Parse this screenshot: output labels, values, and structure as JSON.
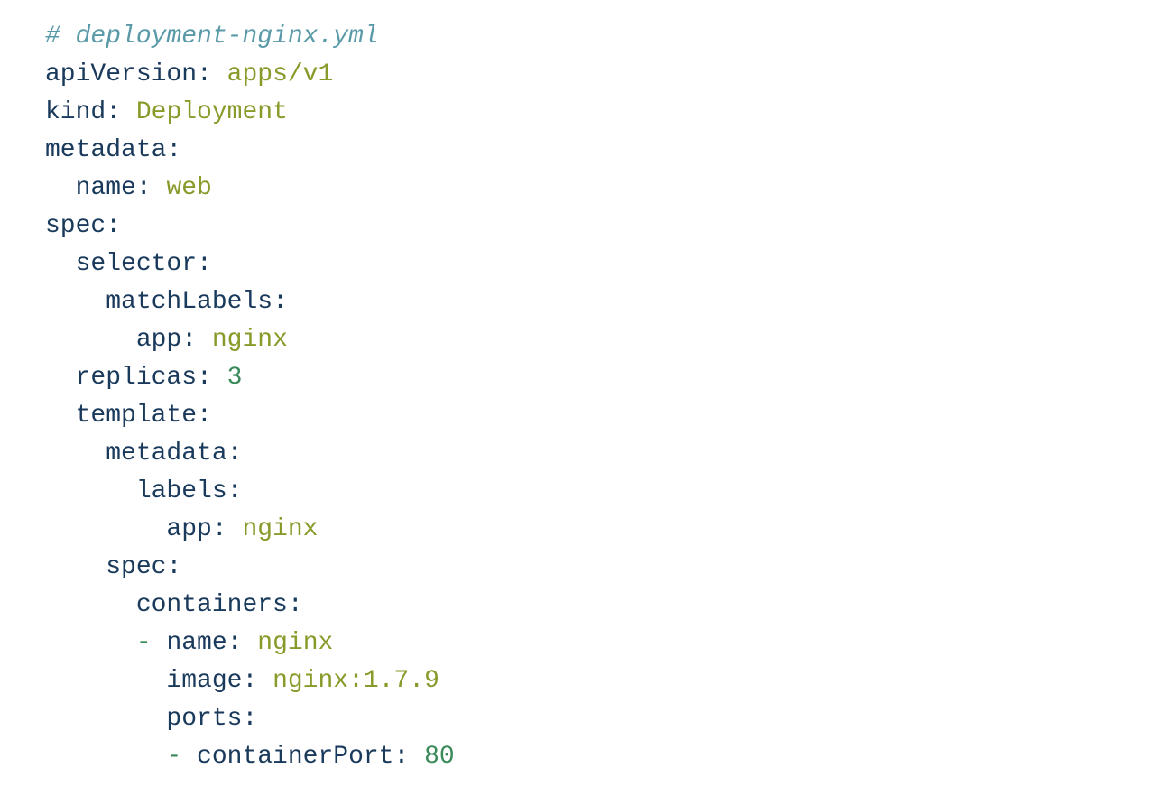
{
  "code": {
    "comment": "# deployment-nginx.yml",
    "apiVersion_key": "apiVersion",
    "apiVersion_val": "apps/v1",
    "kind_key": "kind",
    "kind_val": "Deployment",
    "metadata_key": "metadata",
    "name_key": "name",
    "name_val": "web",
    "spec_key": "spec",
    "selector_key": "selector",
    "matchLabels_key": "matchLabels",
    "app_key": "app",
    "app_val": "nginx",
    "replicas_key": "replicas",
    "replicas_val": "3",
    "template_key": "template",
    "labels_key": "labels",
    "containers_key": "containers",
    "container_name_val": "nginx",
    "image_key": "image",
    "image_val": "nginx:1.7.9",
    "ports_key": "ports",
    "containerPort_key": "containerPort",
    "containerPort_val": "80",
    "colon": ":",
    "dash": "-",
    "space": " "
  }
}
